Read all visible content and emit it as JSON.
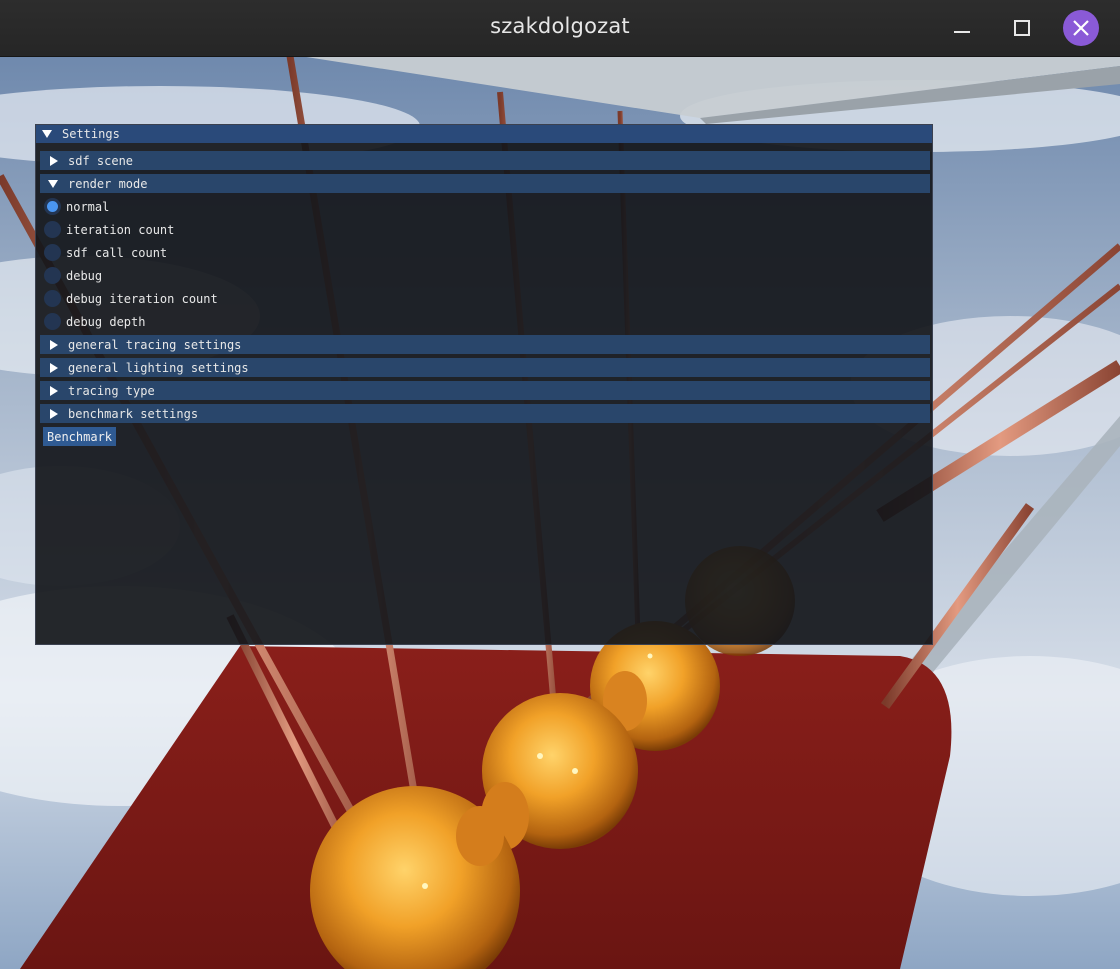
{
  "window": {
    "title": "szakdolgozat",
    "close_color": "#8a5ad7"
  },
  "settings": {
    "title": "Settings",
    "sections": {
      "sdf_scene": "sdf scene",
      "render_mode": "render mode",
      "general_tracing": "general tracing settings",
      "general_lighting": "general lighting settings",
      "tracing_type": "tracing type",
      "benchmark_settings": "benchmark settings"
    },
    "render_mode_options": [
      {
        "label": "normal",
        "selected": true
      },
      {
        "label": "iteration count",
        "selected": false
      },
      {
        "label": "sdf call count",
        "selected": false
      },
      {
        "label": "debug",
        "selected": false
      },
      {
        "label": "debug iteration count",
        "selected": false
      },
      {
        "label": "debug depth",
        "selected": false
      }
    ],
    "benchmark_button": "Benchmark"
  }
}
